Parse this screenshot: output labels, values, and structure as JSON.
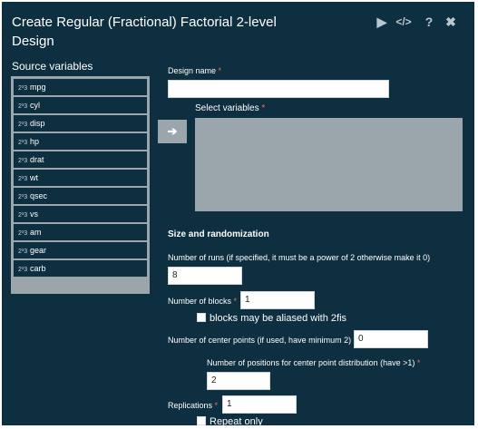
{
  "dialog": {
    "title": "Create Regular (Fractional) Factorial 2-level Design",
    "icons": [
      {
        "name": "run-icon",
        "glyph": "▶"
      },
      {
        "name": "code-icon",
        "glyph": "</>"
      },
      {
        "name": "help-icon",
        "glyph": "?"
      },
      {
        "name": "close-icon",
        "glyph": "✖"
      }
    ]
  },
  "source": {
    "label": "Source variables",
    "variable_icon": "numeric-variable-icon",
    "variables": [
      "mpg",
      "cyl",
      "disp",
      "hp",
      "drat",
      "wt",
      "qsec",
      "vs",
      "am",
      "gear",
      "carb"
    ]
  },
  "move_button": {
    "icon": "arrow-right-icon",
    "glyph": "➔"
  },
  "design_name": {
    "label": "Design name",
    "required_mark": "*",
    "value": ""
  },
  "select_variables": {
    "label": "Select variables",
    "required_mark": "*"
  },
  "size": {
    "heading": "Size and randomization",
    "runs": {
      "label": "Number of runs (if specified, it must be a power of 2 otherwise make it 0)",
      "value": "8"
    },
    "blocks": {
      "label": "Number of blocks",
      "required_mark": "*",
      "value": "1"
    },
    "aliased": {
      "label": "blocks may be aliased with 2fis",
      "checked": false
    },
    "center_points": {
      "label": "Number of center points (if used, have minimum 2)",
      "required_mark": "*",
      "value": "0"
    },
    "positions": {
      "label": "Number of positions for center point distribution (have >1)",
      "required_mark": "*",
      "value": "2"
    },
    "replications": {
      "label": "Replications",
      "required_mark": "*",
      "value": "1"
    },
    "repeat_only": {
      "label": "Repeat only",
      "checked": false
    }
  },
  "colors": {
    "background": "#0e2f3f",
    "panel": "#9aa6ac",
    "required": "#e8715e"
  }
}
